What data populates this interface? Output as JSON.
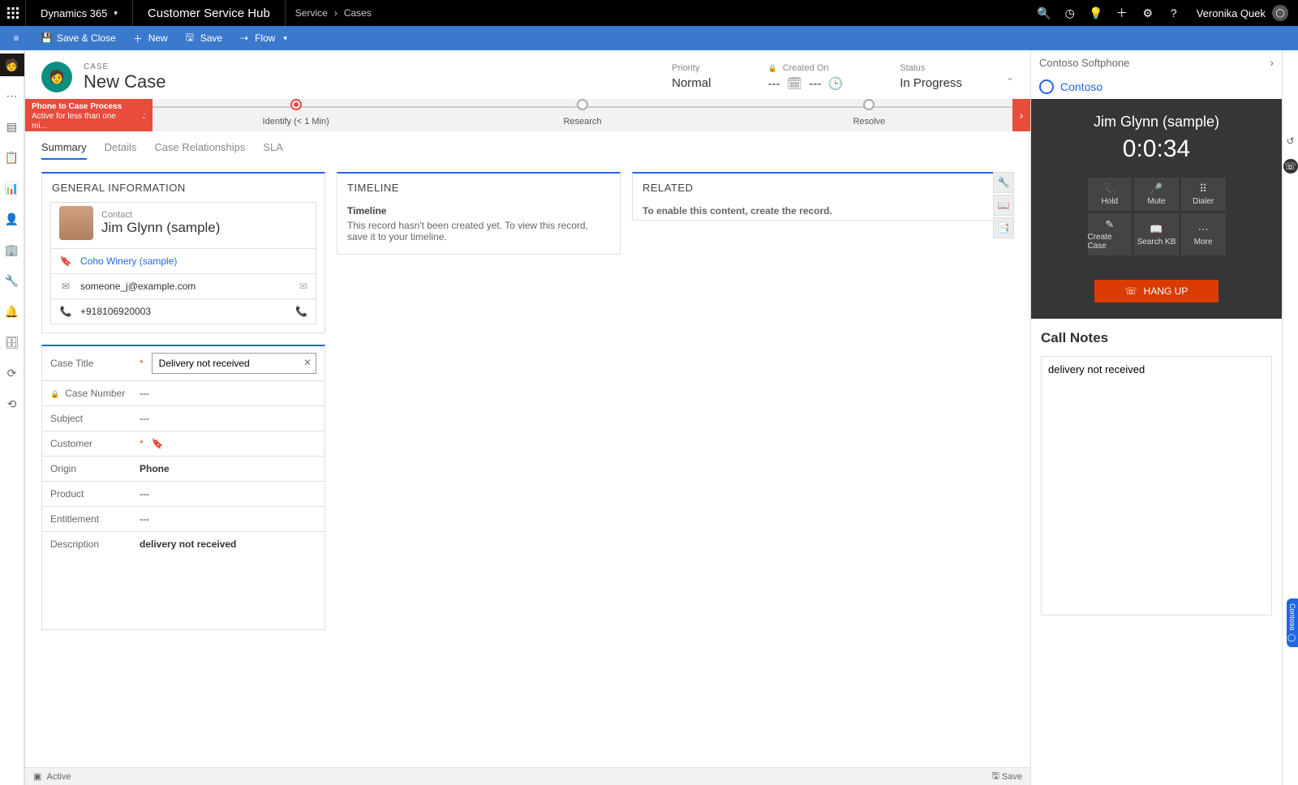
{
  "topbar": {
    "brand": "Dynamics 365",
    "hub": "Customer Service Hub",
    "crumb1": "Service",
    "crumb2": "Cases",
    "user": "Veronika Quek"
  },
  "cmdbar": {
    "save_close": "Save & Close",
    "new": "New",
    "save": "Save",
    "flow": "Flow"
  },
  "record": {
    "entity": "CASE",
    "title": "New Case",
    "priority_label": "Priority",
    "priority_value": "Normal",
    "created_label": "Created On",
    "created_value": "---",
    "created_value2": "---",
    "status_label": "Status",
    "status_value": "In Progress"
  },
  "bpf": {
    "flag_line1": "Phone to Case Process",
    "flag_line2": "Active for less than one mi...",
    "stage1": "Identify (< 1 Min)",
    "stage2": "Research",
    "stage3": "Resolve"
  },
  "tabs": {
    "t1": "Summary",
    "t2": "Details",
    "t3": "Case Relationships",
    "t4": "SLA"
  },
  "general": {
    "head": "GENERAL INFORMATION",
    "contact_label": "Contact",
    "contact_name": "Jim Glynn (sample)",
    "company": "Coho Winery (sample)",
    "email": "someone_j@example.com",
    "phone": "+918106920003"
  },
  "form": {
    "case_title_label": "Case Title",
    "case_title_value": "Delivery not received",
    "case_number_label": "Case Number",
    "case_number_value": "---",
    "subject_label": "Subject",
    "subject_value": "---",
    "customer_label": "Customer",
    "origin_label": "Origin",
    "origin_value": "Phone",
    "product_label": "Product",
    "product_value": "---",
    "entitlement_label": "Entitlement",
    "entitlement_value": "---",
    "description_label": "Description",
    "description_value": "delivery not received"
  },
  "timeline": {
    "head": "TIMELINE",
    "title": "Timeline",
    "msg": "This record hasn't been created yet.  To view this record, save it to your timeline."
  },
  "related": {
    "head": "RELATED",
    "msg": "To enable this content, create the record."
  },
  "softphone": {
    "title": "Contoso Softphone",
    "brand": "Contoso",
    "call_name": "Jim Glynn (sample)",
    "timer": "0:0:34",
    "b_hold": "Hold",
    "b_mute": "Mute",
    "b_dialer": "Dialer",
    "b_case": "Create Case",
    "b_kb": "Search KB",
    "b_more": "More",
    "hangup": "HANG UP",
    "notes_head": "Call Notes",
    "notes_value": "delivery not received"
  },
  "statusbar": {
    "state": "Active",
    "save": "Save"
  },
  "rightpill": "Contoso"
}
